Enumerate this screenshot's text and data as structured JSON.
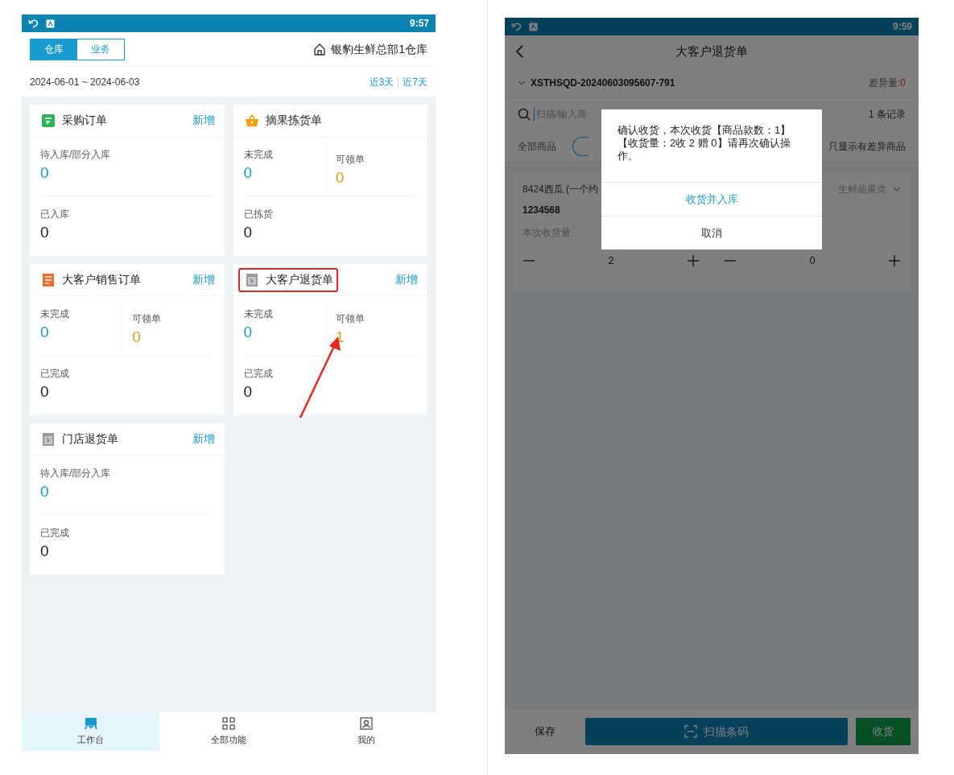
{
  "left_screen": {
    "status_bar": {
      "time": "9:57"
    },
    "tabs": [
      {
        "label": "仓库",
        "selected": true
      },
      {
        "label": "业务",
        "selected": false
      }
    ],
    "warehouse": "银豹生鲜总部1仓库",
    "date_range": "2024-06-01 ~ 2024-06-03",
    "quick_ranges": [
      "近3天",
      "近7天"
    ],
    "cards": [
      {
        "title": "采购订单",
        "action": "新增",
        "highlighted": false,
        "rows": [
          [
            {
              "label": "待入库/部分入库",
              "value": "0"
            }
          ],
          [
            {
              "label": "已入库",
              "value": "0"
            }
          ]
        ]
      },
      {
        "title": "摘果拣货单",
        "highlighted": false,
        "rows": [
          [
            {
              "label": "未完成",
              "value": "0"
            },
            {
              "label": "可领单",
              "value": "0"
            }
          ],
          [
            {
              "label": "已拣货",
              "value": "0"
            }
          ]
        ]
      },
      {
        "title": "大客户销售订单",
        "action": "新增",
        "highlighted": false,
        "rows": [
          [
            {
              "label": "未完成",
              "value": "0"
            },
            {
              "label": "可领单",
              "value": "0"
            }
          ],
          [
            {
              "label": "已完成",
              "value": "0"
            }
          ]
        ]
      },
      {
        "title": "大客户退货单",
        "action": "新增",
        "highlighted": true,
        "rows": [
          [
            {
              "label": "未完成",
              "value": "0"
            },
            {
              "label": "可领单",
              "value": "1"
            }
          ],
          [
            {
              "label": "已完成",
              "value": "0"
            }
          ]
        ]
      },
      {
        "title": "门店退货单",
        "action": "新增",
        "highlighted": false,
        "rows": [
          [
            {
              "label": "待入库/部分入库",
              "value": "0"
            }
          ],
          [
            {
              "label": "已完成",
              "value": "0"
            }
          ]
        ]
      }
    ],
    "nav": [
      {
        "label": "工作台",
        "selected": true
      },
      {
        "label": "全部功能",
        "selected": false
      },
      {
        "label": "我的",
        "selected": false
      }
    ]
  },
  "right_screen": {
    "status_bar": {
      "time": "9:59"
    },
    "title": "大客户退货单",
    "order_no": "XSTHSQD-20240603095607-791",
    "diff_label": "差异量:",
    "diff_value": "0",
    "search": {
      "placeholder": "扫描/输入商"
    },
    "record_count": "1 条记录",
    "filter": "全部商品",
    "only_diff": "只显示有差异商品",
    "item": {
      "name": "8424西瓜 (一个约",
      "category": "生鲜蔬果类",
      "code": "1234568",
      "qty_label": "本次收货量",
      "qty": "2",
      "gift": "0"
    },
    "dialog": {
      "message": "确认收货，本次收货【商品款数：1】【收货量：2收 2 赠 0】请再次确认操作。",
      "actions": [
        {
          "label": "收货并入库",
          "kind": "primary"
        },
        {
          "label": "取消",
          "kind": "cancel"
        }
      ]
    },
    "bottom": {
      "save": "保存",
      "scan": "扫描条码",
      "receive": "收货"
    }
  }
}
